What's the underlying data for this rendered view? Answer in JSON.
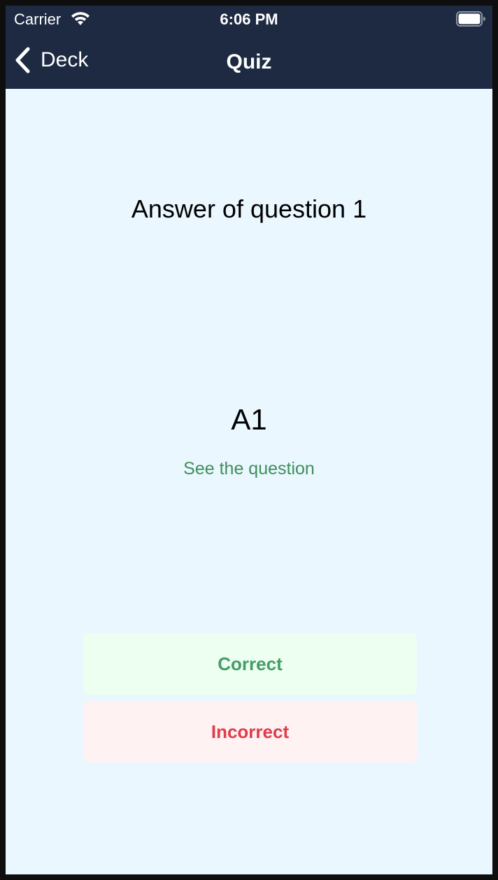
{
  "status_bar": {
    "carrier": "Carrier",
    "time": "6:06 PM",
    "icons": [
      "wifi-icon",
      "battery-icon"
    ]
  },
  "nav": {
    "back_label": "Deck",
    "title": "Quiz"
  },
  "card": {
    "heading": "Answer of question 1",
    "answer": "A1",
    "toggle_label": "See the question"
  },
  "actions": {
    "correct_label": "Correct",
    "incorrect_label": "Incorrect"
  },
  "colors": {
    "header_bg": "#1d2a41",
    "page_bg": "#eaf7ff",
    "link_green": "#3e8f5b",
    "correct_bg": "#ecfff1",
    "correct_text": "#459c68",
    "incorrect_bg": "#fff2f3",
    "incorrect_text": "#df3d49"
  }
}
